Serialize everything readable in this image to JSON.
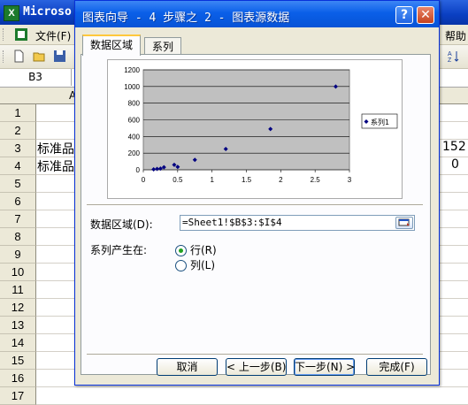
{
  "excel": {
    "title": "Microso",
    "logo": "X",
    "menu_file": "文件(F)",
    "menu_help": "帮助",
    "name_box": "B3",
    "row_numbers": [
      "1",
      "2",
      "3",
      "4",
      "5",
      "6",
      "7",
      "8",
      "9",
      "10",
      "11",
      "12",
      "13",
      "14",
      "15",
      "16",
      "17"
    ],
    "cells": {
      "a3": "标准品",
      "a4": "标准品",
      "right3": "152",
      "right4": "0"
    },
    "col_header_partial": "A",
    "toolbar_right_icon": "sort-az-icon"
  },
  "dialog": {
    "title": "图表向导 - 4 步骤之 2 - 图表源数据",
    "help_label": "?",
    "close_label": "✕",
    "tabs": [
      {
        "label": "数据区域",
        "active": true
      },
      {
        "label": "系列",
        "active": false
      }
    ],
    "range_label": "数据区域(D):",
    "range_value": "=Sheet1!$B$3:$I$4",
    "series_in_label": "系列产生在:",
    "radio_rows": "行(R)",
    "radio_cols": "列(L)",
    "selected_series_in": "rows",
    "buttons": {
      "cancel": "取消",
      "back": "< 上一步(B)",
      "next": "下一步(N) >",
      "finish": "完成(F)"
    }
  },
  "chart_data": {
    "type": "scatter",
    "series": [
      {
        "name": "系列1",
        "x": [
          0.15,
          0.2,
          0.25,
          0.3,
          0.45,
          0.5,
          0.75,
          1.2,
          1.85,
          2.8
        ],
        "y": [
          5,
          10,
          15,
          30,
          60,
          35,
          120,
          250,
          490,
          1000
        ]
      }
    ],
    "xlim": [
      0,
      3
    ],
    "ylim": [
      0,
      1200
    ],
    "x_ticks": [
      "0",
      "0.5",
      "1",
      "1.5",
      "2",
      "2.5",
      "3"
    ],
    "y_ticks": [
      "0",
      "200",
      "400",
      "600",
      "800",
      "1000",
      "1200"
    ],
    "plot_background": "#c0c0c0",
    "marker_color": "#000080",
    "grid": true,
    "legend_position": "right"
  },
  "colors": {
    "dialog_title": "#0a5fe8",
    "face": "#ece9d8",
    "tab_highlight": "#ffc83c"
  }
}
